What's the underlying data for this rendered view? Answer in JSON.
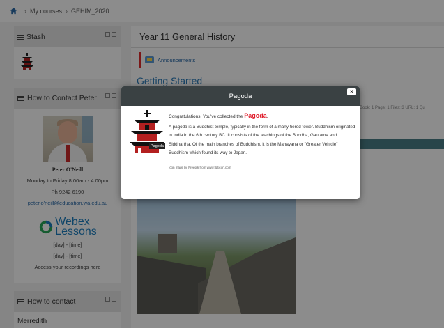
{
  "breadcrumb": {
    "items": [
      "My courses",
      "GEHIM_2020"
    ]
  },
  "stash": {
    "title": "Stash"
  },
  "contact_peter": {
    "title": "How to Contact Peter",
    "name": "Peter O'Neill",
    "hours": "Monday to Friday 8:00am - 4:00pm",
    "phone": "Ph 9242 6190",
    "email": "peter.o'neill@education.wa.edu.au",
    "webex_line1": "Webex",
    "webex_line2": "Lessons",
    "day_time_1": "[day] - [time]",
    "day_time_2": "[day] - [time]",
    "recordings": "Access your recordings here"
  },
  "contact_other": {
    "title": "How to contact",
    "name": "Merredith"
  },
  "main": {
    "course_title": "Year 11 General History",
    "announcements": "Announcements",
    "getting_started": "Getting Started",
    "meta": "Book: 1  Page: 1  Files: 3  URL: 1  Qu"
  },
  "modal": {
    "title": "Pagoda",
    "close_label": "×",
    "congrats_prefix": "Congratulations! You've collected the ",
    "item_name": "Pagoda",
    "congrats_suffix": ".",
    "description": "A pagoda is a Buddhist temple, typically in the form of a many-tiered tower. Buddhism originated in India in the 6th century BC. It consists of the teachings of the Buddha, Gautama and Siddhartha. Of the main branches of Buddhism, it is the Mahayana or \"Greater Vehicle\" Buddhism which found its way to Japan.",
    "credit": "Icon made by Freepik from www.flaticon.com",
    "icon_tag": "Pagoda"
  },
  "colors": {
    "accent_link": "#2a6aa8",
    "item_red": "#e0202e",
    "modal_header": "#3a4143",
    "teal_bar": "#4a7f88"
  }
}
